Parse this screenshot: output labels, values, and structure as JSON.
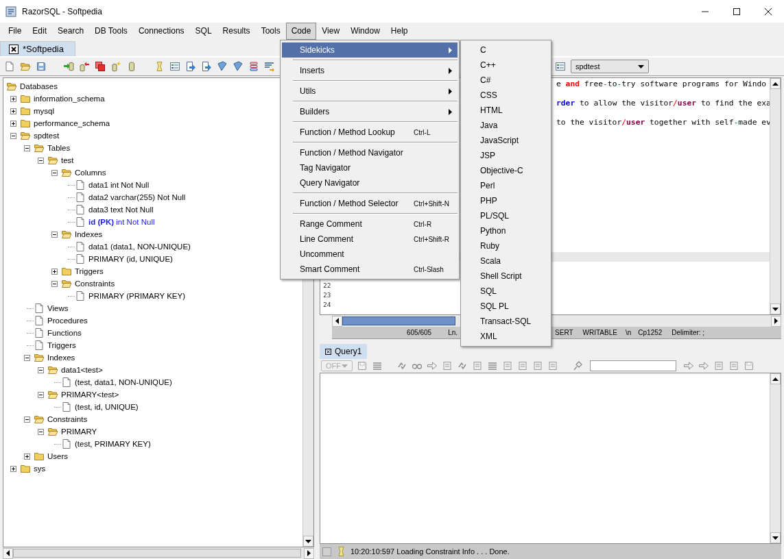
{
  "window": {
    "title": "RazorSQL - Softpedia"
  },
  "menu_bar": [
    {
      "label": "File",
      "selected": false
    },
    {
      "label": "Edit",
      "selected": false
    },
    {
      "label": "Search",
      "selected": false
    },
    {
      "label": "DB Tools",
      "selected": false
    },
    {
      "label": "Connections",
      "selected": false
    },
    {
      "label": "SQL",
      "selected": false
    },
    {
      "label": "Results",
      "selected": false
    },
    {
      "label": "Tools",
      "selected": false
    },
    {
      "label": "Code",
      "selected": true
    },
    {
      "label": "View",
      "selected": false
    },
    {
      "label": "Window",
      "selected": false
    },
    {
      "label": "Help",
      "selected": false
    }
  ],
  "document_tabs": [
    {
      "label": "*Softpedia",
      "selected": true
    }
  ],
  "connection_selector": {
    "value": "spdtest"
  },
  "tree": [
    {
      "label": "Databases",
      "kind": "folder",
      "expanded": true,
      "children": [
        {
          "label": "information_schema",
          "kind": "folder",
          "expanded": false
        },
        {
          "label": "mysql",
          "kind": "folder",
          "expanded": false
        },
        {
          "label": "performance_schema",
          "kind": "folder",
          "expanded": false
        },
        {
          "label": "spdtest",
          "kind": "folder",
          "expanded": true,
          "children": [
            {
              "label": "Tables",
              "kind": "folder",
              "expanded": true,
              "children": [
                {
                  "label": "test",
                  "kind": "folder",
                  "expanded": true,
                  "children": [
                    {
                      "label": "Columns",
                      "kind": "folder",
                      "expanded": true,
                      "children": [
                        {
                          "label": "data1 int Not Null",
                          "kind": "file"
                        },
                        {
                          "label": "data2 varchar(255) Not Null",
                          "kind": "file"
                        },
                        {
                          "label": "data3 text Not Null",
                          "kind": "file"
                        },
                        {
                          "label": "**id (PK)** int Not Null",
                          "kind": "key"
                        }
                      ]
                    },
                    {
                      "label": "Indexes",
                      "kind": "folder",
                      "expanded": true,
                      "children": [
                        {
                          "label": "data1 (data1, NON-UNIQUE)",
                          "kind": "file"
                        },
                        {
                          "label": "PRIMARY (id, UNIQUE)",
                          "kind": "file"
                        }
                      ]
                    },
                    {
                      "label": "Triggers",
                      "kind": "folder",
                      "expanded": false
                    },
                    {
                      "label": "Constraints",
                      "kind": "folder",
                      "expanded": true,
                      "children": [
                        {
                          "label": "PRIMARY (PRIMARY KEY)",
                          "kind": "file"
                        }
                      ]
                    }
                  ]
                }
              ]
            },
            {
              "label": "Views",
              "kind": "file"
            },
            {
              "label": "Procedures",
              "kind": "file"
            },
            {
              "label": "Functions",
              "kind": "file"
            },
            {
              "label": "Triggers",
              "kind": "file"
            },
            {
              "label": "Indexes",
              "kind": "folder",
              "expanded": true,
              "children": [
                {
                  "label": "data1<test>",
                  "kind": "folder",
                  "expanded": true,
                  "children": [
                    {
                      "label": "(test, data1, NON-UNIQUE)",
                      "kind": "file"
                    }
                  ]
                },
                {
                  "label": "PRIMARY<test>",
                  "kind": "folder",
                  "expanded": true,
                  "children": [
                    {
                      "label": "(test, id, UNIQUE)",
                      "kind": "file"
                    }
                  ]
                }
              ]
            },
            {
              "label": "Constraints",
              "kind": "folder",
              "expanded": true,
              "children": [
                {
                  "label": "PRIMARY",
                  "kind": "folder",
                  "expanded": true,
                  "children": [
                    {
                      "label": "(test, PRIMARY KEY)",
                      "kind": "file"
                    }
                  ]
                }
              ]
            },
            {
              "label": "Users",
              "kind": "folder",
              "expanded": false
            }
          ]
        },
        {
          "label": "sys",
          "kind": "folder",
          "expanded": false
        }
      ]
    }
  ],
  "code_menu": {
    "groups": [
      {
        "items": [
          {
            "label": "Sidekicks",
            "submenu": true,
            "selected": true
          }
        ]
      },
      {
        "items": [
          {
            "label": "Inserts",
            "submenu": true,
            "selected": false
          }
        ]
      },
      {
        "items": [
          {
            "label": "Utils",
            "submenu": true,
            "selected": false
          }
        ]
      },
      {
        "items": [
          {
            "label": "Builders",
            "submenu": true,
            "selected": false
          }
        ]
      },
      {
        "items": [
          {
            "label": "Function / Method Lookup",
            "shortcut": "Ctrl-L",
            "submenu": false,
            "selected": false
          }
        ]
      },
      {
        "items": [
          {
            "label": "Function / Method Navigator",
            "submenu": false,
            "selected": false
          },
          {
            "label": "Tag Navigator",
            "submenu": false,
            "selected": false
          },
          {
            "label": "Query Navigator",
            "submenu": false,
            "selected": false
          }
        ]
      },
      {
        "items": [
          {
            "label": "Function / Method Selector",
            "shortcut": "Ctrl+Shift-N",
            "submenu": false,
            "selected": false
          }
        ]
      },
      {
        "items": [
          {
            "label": "Range Comment",
            "shortcut": "Ctrl-R",
            "submenu": false,
            "selected": false
          },
          {
            "label": "Line Comment",
            "shortcut": "Ctrl+Shift-R",
            "submenu": false,
            "selected": false
          },
          {
            "label": "Uncomment",
            "submenu": false,
            "selected": false
          },
          {
            "label": "Smart Comment",
            "shortcut": "Ctrl-Slash",
            "submenu": false,
            "selected": false
          }
        ]
      }
    ]
  },
  "sidekicks_menu": {
    "items": [
      {
        "label": "C",
        "selected": false
      },
      {
        "label": "C++",
        "selected": false
      },
      {
        "label": "C#",
        "selected": false
      },
      {
        "label": "CSS",
        "selected": false
      },
      {
        "label": "HTML",
        "selected": false
      },
      {
        "label": "Java",
        "selected": false
      },
      {
        "label": "JavaScript",
        "selected": false
      },
      {
        "label": "JSP",
        "selected": false
      },
      {
        "label": "Objective-C",
        "selected": false
      },
      {
        "label": "Perl",
        "selected": false
      },
      {
        "label": "PHP",
        "selected": false
      },
      {
        "label": "PL/SQL",
        "selected": false
      },
      {
        "label": "Python",
        "selected": false
      },
      {
        "label": "Ruby",
        "selected": false
      },
      {
        "label": "Scala",
        "selected": false
      },
      {
        "label": "Shell Script",
        "selected": false
      },
      {
        "label": "SQL",
        "selected": false
      },
      {
        "label": "SQL PL",
        "selected": false
      },
      {
        "label": "Transact-SQL",
        "selected": false
      },
      {
        "label": "XML",
        "selected": false
      }
    ]
  },
  "editor": {
    "code_lines": [
      {
        "tokens": [
          {
            "text": "e ",
            "kind": "plain"
          },
          {
            "text": "and",
            "kind": "keyword"
          },
          {
            "text": " free",
            "kind": "plain"
          },
          {
            "text": "-",
            "kind": "operator"
          },
          {
            "text": "to",
            "kind": "plain"
          },
          {
            "text": "-",
            "kind": "operator"
          },
          {
            "text": "try software programs for Windo",
            "kind": "plain"
          }
        ]
      },
      {
        "tokens": [
          {
            "text": "rder",
            "kind": "reserved"
          },
          {
            "text": " to allow the visitor",
            "kind": "plain"
          },
          {
            "text": "/",
            "kind": "operator"
          },
          {
            "text": "user",
            "kind": "type"
          },
          {
            "text": " to find the exa",
            "kind": "plain"
          }
        ]
      },
      {
        "tokens": [
          {
            "text": "to the visitor",
            "kind": "plain"
          },
          {
            "text": "/",
            "kind": "operator"
          },
          {
            "text": "user",
            "kind": "type"
          },
          {
            "text": " together with self",
            "kind": "plain"
          },
          {
            "text": "-",
            "kind": "operator"
          },
          {
            "text": "made ev",
            "kind": "plain"
          }
        ]
      }
    ],
    "line_numbers": [
      "22",
      "23",
      "24"
    ],
    "status": [
      "605/605",
      "Ln.",
      "SERT",
      "WRITABLE",
      "\\n",
      "Cp1252",
      "Delimiter: ;"
    ]
  },
  "query_tabs": [
    {
      "label": "Query1",
      "selected": true
    }
  ],
  "query_toolbar": {
    "mode": {
      "value": "OFF",
      "disabled": true
    }
  },
  "status_bar": {
    "message": "10:20:10:597 Loading Constraint Info . . . Done."
  }
}
